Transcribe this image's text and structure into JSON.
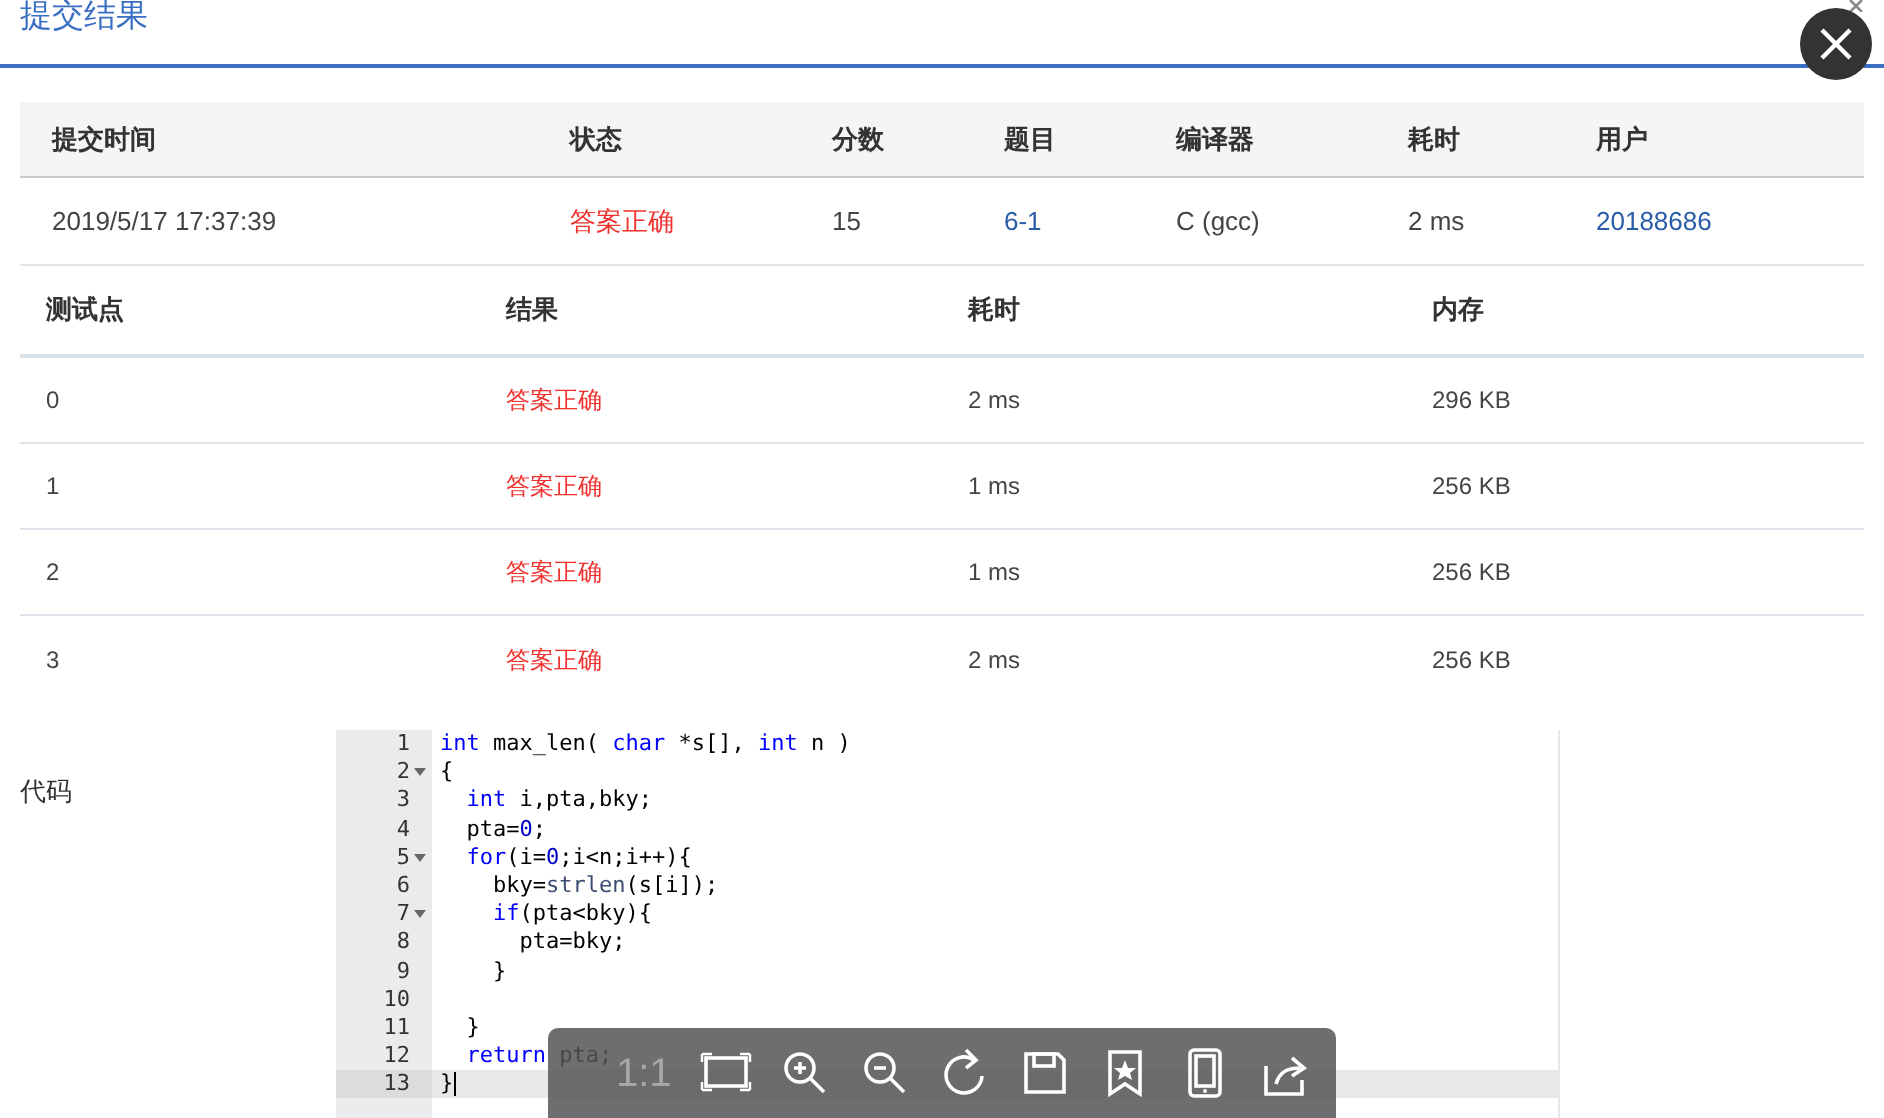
{
  "dialog": {
    "title": "提交结果"
  },
  "submission": {
    "columns": [
      "提交时间",
      "状态",
      "分数",
      "题目",
      "编译器",
      "耗时",
      "用户"
    ],
    "row": [
      {
        "text": "2019/5/17 17:37:39",
        "kind": "plain"
      },
      {
        "text": "答案正确",
        "kind": "status"
      },
      {
        "text": "15",
        "kind": "plain"
      },
      {
        "text": "6-1",
        "kind": "link"
      },
      {
        "text": "C (gcc)",
        "kind": "plain"
      },
      {
        "text": "2 ms",
        "kind": "plain"
      },
      {
        "text": "20188686",
        "kind": "link"
      }
    ]
  },
  "tests": {
    "columns": [
      "测试点",
      "结果",
      "耗时",
      "内存"
    ],
    "rows": [
      [
        "0",
        "答案正确",
        "2 ms",
        "296 KB"
      ],
      [
        "1",
        "答案正确",
        "1 ms",
        "256 KB"
      ],
      [
        "2",
        "答案正确",
        "1 ms",
        "256 KB"
      ],
      [
        "3",
        "答案正确",
        "2 ms",
        "256 KB"
      ]
    ]
  },
  "code": {
    "label": "代码",
    "lines": [
      {
        "number": "1",
        "fold": false,
        "current": false,
        "tokens": [
          {
            "kind": "keyword",
            "text": "int"
          },
          {
            "kind": "plain",
            "text": " max_len( "
          },
          {
            "kind": "keyword",
            "text": "char"
          },
          {
            "kind": "plain",
            "text": " *s[], "
          },
          {
            "kind": "keyword",
            "text": "int"
          },
          {
            "kind": "plain",
            "text": " n )"
          }
        ]
      },
      {
        "number": "2",
        "fold": true,
        "current": false,
        "tokens": [
          {
            "kind": "plain",
            "text": "{"
          }
        ]
      },
      {
        "number": "3",
        "fold": false,
        "current": false,
        "tokens": [
          {
            "kind": "keyword",
            "text": "  int"
          },
          {
            "kind": "plain",
            "text": " i,pta,bky;"
          }
        ]
      },
      {
        "number": "4",
        "fold": false,
        "current": false,
        "tokens": [
          {
            "kind": "plain",
            "text": "  pta="
          },
          {
            "kind": "number",
            "text": "0"
          },
          {
            "kind": "plain",
            "text": ";"
          }
        ]
      },
      {
        "number": "5",
        "fold": true,
        "current": false,
        "tokens": [
          {
            "kind": "keyword",
            "text": "  for"
          },
          {
            "kind": "plain",
            "text": "(i="
          },
          {
            "kind": "number",
            "text": "0"
          },
          {
            "kind": "plain",
            "text": ";i<n;i++){"
          }
        ]
      },
      {
        "number": "6",
        "fold": false,
        "current": false,
        "tokens": [
          {
            "kind": "plain",
            "text": "    bky="
          },
          {
            "kind": "function",
            "text": "strlen"
          },
          {
            "kind": "plain",
            "text": "(s[i]);"
          }
        ]
      },
      {
        "number": "7",
        "fold": true,
        "current": false,
        "tokens": [
          {
            "kind": "keyword",
            "text": "    if"
          },
          {
            "kind": "plain",
            "text": "(pta<bky){"
          }
        ]
      },
      {
        "number": "8",
        "fold": false,
        "current": false,
        "tokens": [
          {
            "kind": "plain",
            "text": "      pta=bky;"
          }
        ]
      },
      {
        "number": "9",
        "fold": false,
        "current": false,
        "tokens": [
          {
            "kind": "plain",
            "text": "    }"
          }
        ]
      },
      {
        "number": "10",
        "fold": false,
        "current": false
      },
      {
        "number": "11",
        "fold": false,
        "current": false,
        "tokens": [
          {
            "kind": "plain",
            "text": "  }"
          }
        ]
      },
      {
        "number": "12",
        "fold": false,
        "current": false,
        "tokens": [
          {
            "kind": "keyword",
            "text": "  return"
          },
          {
            "kind": "plain",
            "text": " pta;"
          }
        ]
      },
      {
        "number": "13",
        "fold": false,
        "current": true,
        "tokens": [
          {
            "kind": "plain",
            "text": "}"
          }
        ]
      }
    ]
  },
  "viewer_toolbar": [
    {
      "kind": "text",
      "text": "1:1",
      "disabled": true
    },
    {
      "kind": "fit",
      "disabled": false
    },
    {
      "kind": "zoom-in",
      "disabled": false
    },
    {
      "kind": "zoom-out",
      "disabled": false
    },
    {
      "kind": "rotate",
      "disabled": false
    },
    {
      "kind": "save",
      "disabled": false
    },
    {
      "kind": "bookmark",
      "disabled": false
    },
    {
      "kind": "tablet",
      "disabled": false
    },
    {
      "kind": "share",
      "disabled": false
    }
  ]
}
